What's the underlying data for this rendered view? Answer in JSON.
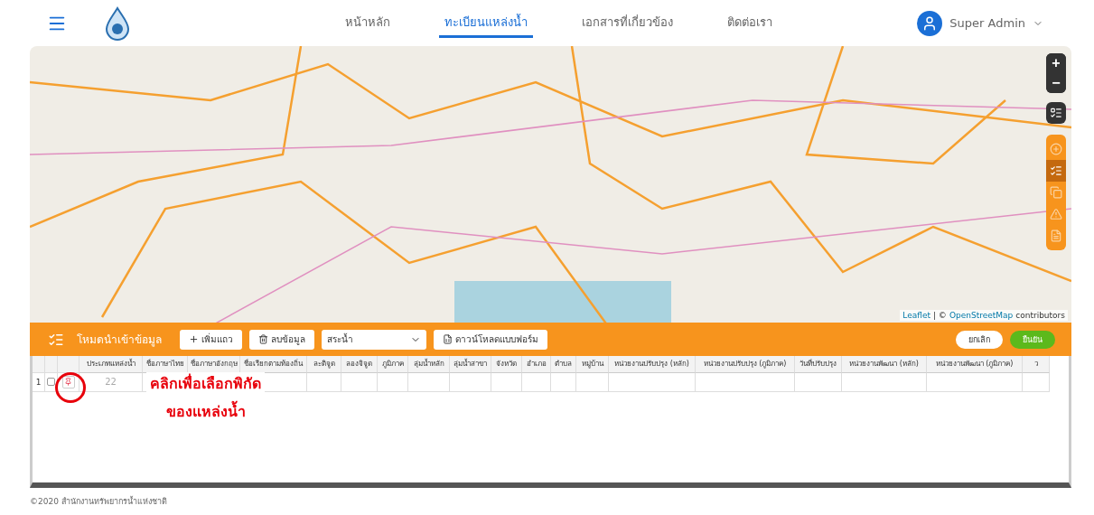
{
  "navbar": {
    "menu": [
      {
        "label": "หน้าหลัก",
        "selected": false
      },
      {
        "label": "ทะเบียนแหล่งน้ำ",
        "selected": true
      },
      {
        "label": "เอกสารที่เกี่ยวข้อง",
        "selected": false
      },
      {
        "label": "ติดต่อเรา",
        "selected": false
      }
    ],
    "user": "Super Admin"
  },
  "map": {
    "attribution_link": "Leaflet",
    "attribution_sep": "| ©",
    "attribution_osm": "OpenStreetMap",
    "attribution_rest": "contributors",
    "zoom_in": "+",
    "zoom_out": "−",
    "tools": [
      {
        "kind": "add",
        "selected": false
      },
      {
        "kind": "form",
        "selected": true
      },
      {
        "kind": "layers",
        "selected": false
      },
      {
        "kind": "warning",
        "selected": false
      },
      {
        "kind": "document",
        "selected": false
      }
    ]
  },
  "import_bar": {
    "title": "โหมดนำเข้าข้อมูล",
    "add_row": "เพิ่มแถว",
    "delete": "ลบข้อมูล",
    "type_select": "สระน้ำ",
    "download": "ดาวน์โหลดแบบฟอร์ม",
    "cancel": "ยกเลิก",
    "confirm": "ยืนยัน"
  },
  "grid": {
    "columns": [
      "ประเภทแหล่งน้ำ",
      "ชื่อภาษาไทย",
      "ชื่อภาษาอังกฤษ",
      "ชื่อเรียกตามท้องถิ่น",
      "ละติจูด",
      "ลองจิจูด",
      "ภูมิภาค",
      "ลุ่มน้ำหลัก",
      "ลุ่มน้ำสาขา",
      "จังหวัด",
      "อำเภอ",
      "ตำบล",
      "หมู่บ้าน",
      "หน่วยงานปรับปรุง (หลัก)",
      "หน่วยงานปรับปรุง (ภูมิภาค)",
      "วันที่ปรับปรุง",
      "หน่วยงานพัฒนา (หลัก)",
      "หน่วยงานพัฒนา (ภูมิภาค)",
      "ว"
    ],
    "rows": [
      {
        "number": "1",
        "checked": false,
        "type_value": "22"
      }
    ]
  },
  "annotation": {
    "line1": "คลิกเพื่อเลือกพิกัด",
    "line2": "ของแหล่งน้ำ"
  },
  "footer": "©2020 สำนักงานทรัพยากรน้ำแห่งชาติ"
}
